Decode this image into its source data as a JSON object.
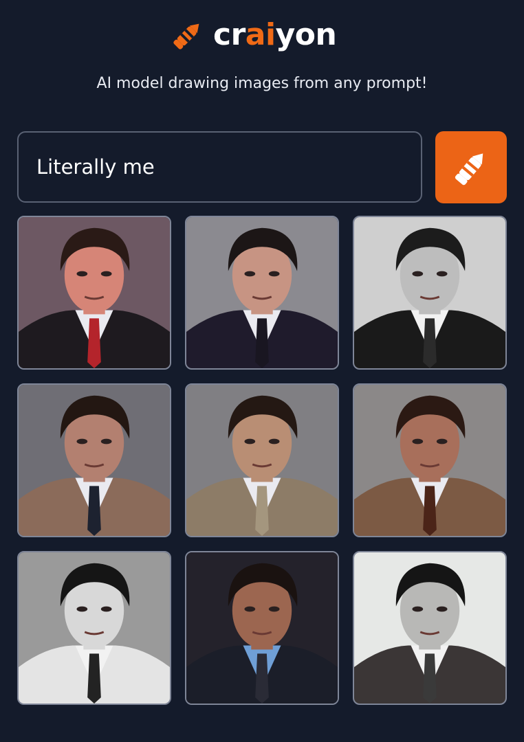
{
  "brand": {
    "name_prefix": "cr",
    "name_accent": "ai",
    "name_suffix": "yon",
    "accent_color": "#f06a16",
    "logo_icon": "crayon-icon"
  },
  "tagline": "AI model drawing images from any prompt!",
  "prompt": {
    "value": "Literally me"
  },
  "draw_button": {
    "icon": "crayon-icon",
    "color": "#ec6416"
  },
  "results": [
    {
      "tone": "color",
      "suit": "#1e1a1f",
      "tie": "#b4242b",
      "skin": "#d68577",
      "hair": "#2a1a16",
      "bg": "#6d5863"
    },
    {
      "tone": "color",
      "suit": "#1f1b2c",
      "tie": "#191621",
      "skin": "#c79483",
      "hair": "#1c1616",
      "bg": "#8b8a90"
    },
    {
      "tone": "mono",
      "suit": "#1a1a1a",
      "tie": "#2b2b2b",
      "skin": "#bdbdbd",
      "hair": "#1c1c1c",
      "bg": "#cfcfcf"
    },
    {
      "tone": "color",
      "suit": "#8b6b5a",
      "tie": "#1d2230",
      "skin": "#b38070",
      "hair": "#231712",
      "bg": "#6f6e75"
    },
    {
      "tone": "color",
      "suit": "#8d7c67",
      "tie": "#a4967e",
      "skin": "#b98e74",
      "hair": "#241813",
      "bg": "#807f83"
    },
    {
      "tone": "color",
      "suit": "#7c5a44",
      "tie": "#4b2418",
      "skin": "#a86f5b",
      "hair": "#2b1913",
      "bg": "#8b8888"
    },
    {
      "tone": "mono",
      "suit": "#e4e4e4",
      "tie": "#232323",
      "skin": "#d8d8d8",
      "hair": "#151515",
      "bg": "#9a9a9a"
    },
    {
      "tone": "color",
      "suit": "#1b1e29",
      "tie": "#2a2b36",
      "skin": "#9c6650",
      "hair": "#1a1210",
      "bg": "#24222b"
    },
    {
      "tone": "mono",
      "suit": "#3b3636",
      "tie": "#3a3a3a",
      "skin": "#b8b8b6",
      "hair": "#151515",
      "bg": "#e6e8e6"
    }
  ]
}
